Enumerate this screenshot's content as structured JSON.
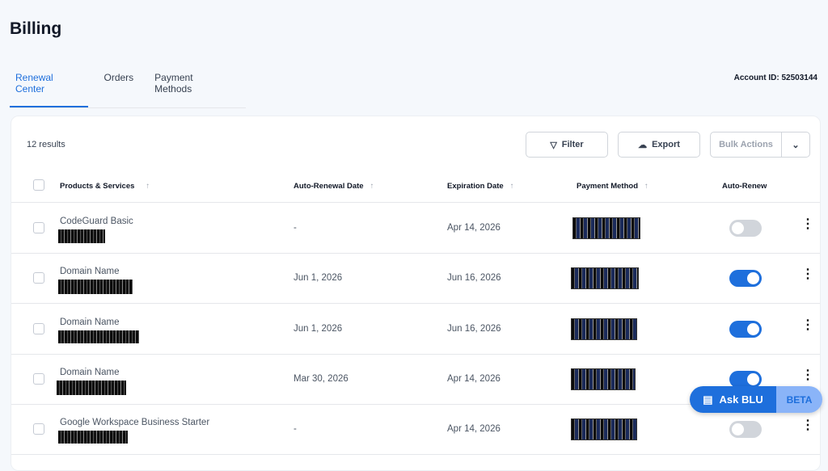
{
  "page": {
    "title": "Billing",
    "account_id": "Account ID: 52503144"
  },
  "tabs": [
    {
      "label": "Renewal Center",
      "active": true
    },
    {
      "label": "Orders"
    },
    {
      "label": "Payment Methods"
    }
  ],
  "toolbar": {
    "results": "12 results",
    "filter": "Filter",
    "export": "Export",
    "bulk": "Bulk Actions"
  },
  "columns": [
    "Products & Services",
    "Auto-Renewal Date",
    "Expiration Date",
    "Payment Method",
    "Auto-Renew"
  ],
  "rows": [
    {
      "name": "CodeGuard Basic",
      "renewal": "-",
      "expiration": "Apr 14, 2026",
      "auto_renew": false
    },
    {
      "name": "Domain Name",
      "renewal": "Jun 1, 2026",
      "expiration": "Jun 16, 2026",
      "auto_renew": true
    },
    {
      "name": "Domain Name",
      "renewal": "Jun 1, 2026",
      "expiration": "Jun 16, 2026",
      "auto_renew": true
    },
    {
      "name": "Domain Name",
      "renewal": "Mar 30, 2026",
      "expiration": "Apr 14, 2026",
      "auto_renew": true
    },
    {
      "name": "Google Workspace Business Starter",
      "renewal": "-",
      "expiration": "Apr 14, 2026",
      "auto_renew": false
    }
  ],
  "assistant": {
    "label": "Ask BLU",
    "badge": "BETA"
  },
  "colors": {
    "accent": "#1e6fdc"
  }
}
